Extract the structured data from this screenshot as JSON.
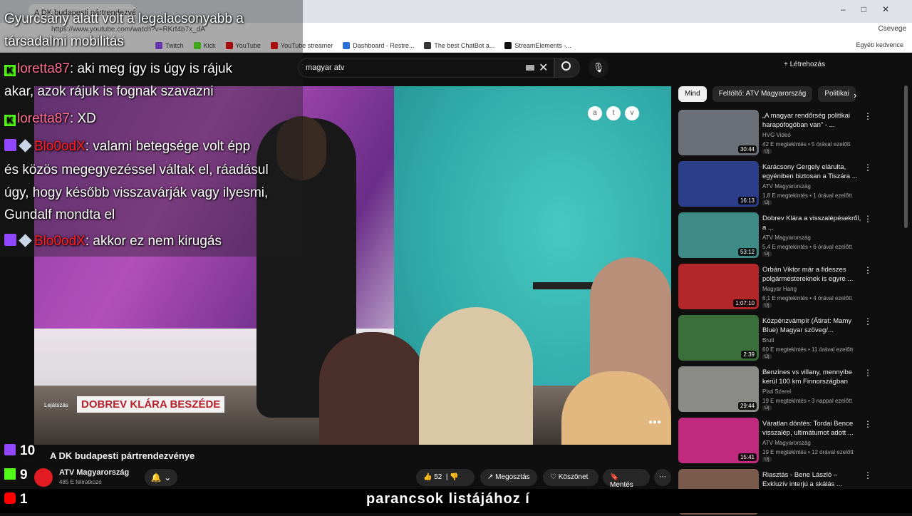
{
  "browser": {
    "tab_title": "A DK budapesti pártrendezvén",
    "url": "https://www.youtube.com/watch?v=RKrf4b7x_dA",
    "right_label": "Csevege",
    "bookmarks": [
      {
        "label": "Twitch",
        "color": "#9146ff"
      },
      {
        "label": "Kick",
        "color": "#53fc18"
      },
      {
        "label": "YouTube",
        "color": "#ff0000"
      },
      {
        "label": "YouTube streamer",
        "color": "#ff0000"
      },
      {
        "label": "Dashboard - Restre...",
        "color": "#2a6fdb"
      },
      {
        "label": "The best ChatBot a...",
        "color": "#333333"
      },
      {
        "label": "StreamElements -...",
        "color": "#111111"
      }
    ],
    "bookmarks_right": "Egyéb kedvence"
  },
  "youtube": {
    "search_value": "magyar atv",
    "create_label": "Létrehozás"
  },
  "chat": {
    "line1": "Gyurcsány alatt volt a legalacsonyabb a",
    "line2": "társadalmi mobilitás",
    "msg1_user": "loretta87",
    "msg1_text": ": aki meg így is úgy is rájuk",
    "msg1_cont": "akar, azok rájuk is fognak szavazni",
    "msg2_user": "loretta87",
    "msg2_text": ": XD",
    "msg3_user": "Blo0odX",
    "msg3_text": ": valami betegsége volt épp",
    "msg3_cont1": "és közös megegyezéssel váltak el, ráadásul",
    "msg3_cont2": "úgy, hogy később visszavárják vagy ilyesmi,",
    "msg3_cont3": "Gundalf mondta el",
    "msg4_user": "Blo0odX",
    "msg4_text": ": akkor ez nem kirugás",
    "kick_badge": "K"
  },
  "video": {
    "lower_third": "DOBREV KLÁRA BESZÉDE",
    "lower_prefix": "Lejátszás",
    "logo_letters": [
      "a",
      "t",
      "v"
    ],
    "title": "A DK budapesti pártrendezvénye"
  },
  "channel": {
    "name": "ATV Magyarország",
    "subs": "485 E feliratkozó"
  },
  "actions": {
    "likes": "52",
    "share": "Megosztás",
    "thanks": "Köszönet",
    "save": "Mentés"
  },
  "counts": {
    "twitch": "10",
    "kick": "9",
    "youtube": "1"
  },
  "chips": [
    "Mind",
    "Feltöltő: ATV Magyarország",
    "Politikai"
  ],
  "recommendations": [
    {
      "title": "„A magyar rendőrség politikai harapófogóban van\" - ...",
      "channel": "HVG Videó",
      "meta": "42 E megtekintés • 5 órával ezelőtt",
      "duration": "30:44",
      "new": "Új",
      "thumb": "#6b6f78"
    },
    {
      "title": "Karácsony Gergely elárulta, egyéniben biztosan a Tiszára ...",
      "channel": "ATV Magyarország",
      "meta": "1,8 E megtekintés • 1 órával ezelőtt",
      "duration": "16:13",
      "new": "Új",
      "thumb": "#2c3e8a"
    },
    {
      "title": "Dobrev Klára a visszalépésekről, a ...",
      "channel": "ATV Magyarország",
      "meta": "5,4 E megtekintés • 6 órával ezelőtt",
      "duration": "53:12",
      "new": "Új",
      "thumb": "#3d8a86"
    },
    {
      "title": "Orbán Viktor már a fideszes polgármestereknek is egyre ...",
      "channel": "Magyar Hang",
      "meta": "6,1 E megtekintés • 4 órával ezelőtt",
      "duration": "1:07:10",
      "new": "Új",
      "thumb": "#b3262a"
    },
    {
      "title": "Közpénzvámpír (Átirat: Mamy Blue) Magyar szöveg/...",
      "channel": "Bruti",
      "meta": "60 E megtekintés • 11 órával ezelőtt",
      "duration": "2:39",
      "new": "Új",
      "thumb": "#3a6e3a"
    },
    {
      "title": "Benzines vs villany, mennyibe kerül 100 km Finnországban",
      "channel": "Pisti Szerel",
      "meta": "19 E megtekintés • 3 nappal ezelőtt",
      "duration": "29:44",
      "new": "Új",
      "thumb": "#8a8a86"
    },
    {
      "title": "Váratlan döntés: Tordai Bence visszalép, ultimátumot adott ...",
      "channel": "ATV Magyarország",
      "meta": "19 E megtekintés • 12 órával ezelőtt",
      "duration": "15:41",
      "new": "Új",
      "thumb": "#c02a7c"
    },
    {
      "title": "Riasztás - Bene László – Exkluzív interjú a skálás ...",
      "channel": "",
      "meta": "",
      "duration": "",
      "new": "",
      "thumb": "#7a5a4a"
    }
  ],
  "bottom_text": "parancsok listájához í"
}
